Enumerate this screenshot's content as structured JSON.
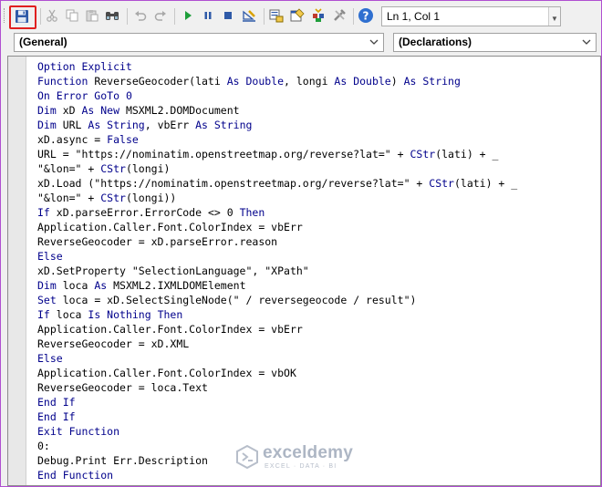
{
  "toolbar": {
    "position_text": "Ln 1, Col 1",
    "icons": [
      "save-icon",
      "cut-icon",
      "copy-icon",
      "paste-icon",
      "find-icon",
      "undo-icon",
      "redo-icon",
      "run-icon",
      "break-icon",
      "reset-icon",
      "design-mode-icon",
      "project-explorer-icon",
      "properties-icon",
      "object-browser-icon",
      "toolbox-icon",
      "help-icon"
    ]
  },
  "object_combo": {
    "value": "(General)"
  },
  "procedure_combo": {
    "value": "(Declarations)"
  },
  "code": {
    "lines": [
      [
        {
          "t": "Option Explicit",
          "k": 1
        }
      ],
      [
        {
          "t": "Function ",
          "k": 1
        },
        {
          "t": "ReverseGeocoder(lati "
        },
        {
          "t": "As Double",
          "k": 1
        },
        {
          "t": ", longi "
        },
        {
          "t": "As Double",
          "k": 1
        },
        {
          "t": ") "
        },
        {
          "t": "As String",
          "k": 1
        }
      ],
      [
        {
          "t": "On Error GoTo ",
          "k": 1
        },
        {
          "t": "0",
          "k": 1
        }
      ],
      [
        {
          "t": "Dim ",
          "k": 1
        },
        {
          "t": "xD "
        },
        {
          "t": "As New ",
          "k": 1
        },
        {
          "t": "MSXML2.DOMDocument"
        }
      ],
      [
        {
          "t": "Dim ",
          "k": 1
        },
        {
          "t": "URL "
        },
        {
          "t": "As String",
          "k": 1
        },
        {
          "t": ", vbErr "
        },
        {
          "t": "As String",
          "k": 1
        }
      ],
      [
        {
          "t": "xD.async = "
        },
        {
          "t": "False",
          "k": 1
        }
      ],
      [
        {
          "t": "URL = \"https://nominatim.openstreetmap.org/reverse?lat=\" + "
        },
        {
          "t": "CStr",
          "k": 1
        },
        {
          "t": "(lati) + _"
        }
      ],
      [
        {
          "t": "\"&lon=\" + "
        },
        {
          "t": "CStr",
          "k": 1
        },
        {
          "t": "(longi)"
        }
      ],
      [
        {
          "t": "xD.Load (\"https://nominatim.openstreetmap.org/reverse?lat=\" + "
        },
        {
          "t": "CStr",
          "k": 1
        },
        {
          "t": "(lati) + _"
        }
      ],
      [
        {
          "t": "\"&lon=\" + "
        },
        {
          "t": "CStr",
          "k": 1
        },
        {
          "t": "(longi))"
        }
      ],
      [
        {
          "t": "If ",
          "k": 1
        },
        {
          "t": "xD.parseError.ErrorCode <> 0 "
        },
        {
          "t": "Then",
          "k": 1
        }
      ],
      [
        {
          "t": "Application.Caller.Font.ColorIndex = vbErr"
        }
      ],
      [
        {
          "t": "ReverseGeocoder = xD.parseError.reason"
        }
      ],
      [
        {
          "t": "Else",
          "k": 1
        }
      ],
      [
        {
          "t": "xD.SetProperty \"SelectionLanguage\", \"XPath\""
        }
      ],
      [
        {
          "t": "Dim ",
          "k": 1
        },
        {
          "t": "loca "
        },
        {
          "t": "As ",
          "k": 1
        },
        {
          "t": "MSXML2.IXMLDOMElement"
        }
      ],
      [
        {
          "t": "Set ",
          "k": 1
        },
        {
          "t": "loca = xD.SelectSingleNode(\" / reversegeocode / result\")"
        }
      ],
      [
        {
          "t": "If ",
          "k": 1
        },
        {
          "t": "loca "
        },
        {
          "t": "Is Nothing Then",
          "k": 1
        }
      ],
      [
        {
          "t": "Application.Caller.Font.ColorIndex = vbErr"
        }
      ],
      [
        {
          "t": "ReverseGeocoder = xD.XML"
        }
      ],
      [
        {
          "t": "Else",
          "k": 1
        }
      ],
      [
        {
          "t": "Application.Caller.Font.ColorIndex = vbOK"
        }
      ],
      [
        {
          "t": "ReverseGeocoder = loca.Text"
        }
      ],
      [
        {
          "t": "End If",
          "k": 1
        }
      ],
      [
        {
          "t": "End If",
          "k": 1
        }
      ],
      [
        {
          "t": "Exit Function",
          "k": 1
        }
      ],
      [
        {
          "t": "0:"
        }
      ],
      [
        {
          "t": "Debug.Print Err.Description"
        }
      ],
      [
        {
          "t": "End Function",
          "k": 1
        }
      ]
    ]
  },
  "watermark": {
    "title": "exceldemy",
    "subtitle": "EXCEL · DATA · BI"
  },
  "colors": {
    "keyword": "#00008b",
    "highlight": "#e02020",
    "frame": "#b04fd1"
  }
}
